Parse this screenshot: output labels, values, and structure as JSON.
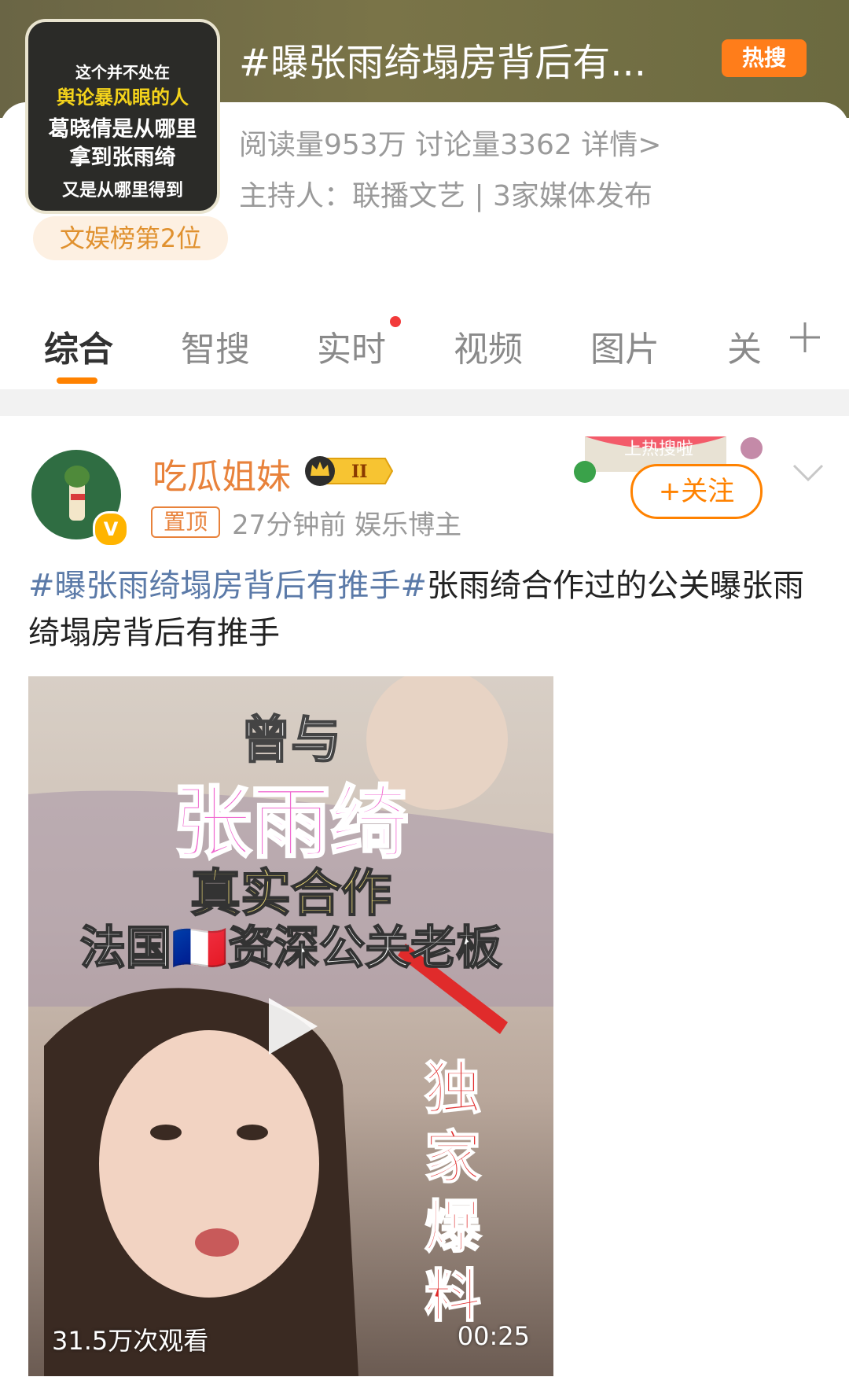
{
  "header": {
    "title": "#曝张雨绮塌房背后有...",
    "hot_tag": "热搜",
    "stats": "阅读量953万  讨论量3362  详情>",
    "host": "主持人：联播文艺 | 3家媒体发布",
    "rank": "文娱榜第2位",
    "thumb_lines": [
      "这个并不处在",
      "舆论暴风眼的人",
      "葛晓倩是从哪里",
      "拿到张雨绮",
      "又是从哪里得到"
    ]
  },
  "tabs": [
    {
      "label": "综合"
    },
    {
      "label": "智搜"
    },
    {
      "label": "实时"
    },
    {
      "label": "视频"
    },
    {
      "label": "图片"
    },
    {
      "label": "关"
    }
  ],
  "post": {
    "user_name": "吃瓜姐妹",
    "vip_level": "II",
    "pin_label": "置顶",
    "meta": "27分钟前  娱乐博主",
    "follow_label": "+关注",
    "decor_text": "上热搜啦",
    "hashtag1": "#曝张雨绮塌房背后有推手#",
    "text": "张雨绮合作过的公关曝张雨绮塌房背后有推手",
    "video": {
      "overlay_lines": [
        "曾与",
        "张雨绮",
        "真实合作",
        "法国🇫🇷资深公关老板"
      ],
      "side_text": "独家爆料",
      "views": "31.5万次观看",
      "duration": "00:25"
    }
  },
  "colors": {
    "accent": "#ff8200",
    "hashtag": "#5b7aa8",
    "hot": "#ff7d1a"
  }
}
